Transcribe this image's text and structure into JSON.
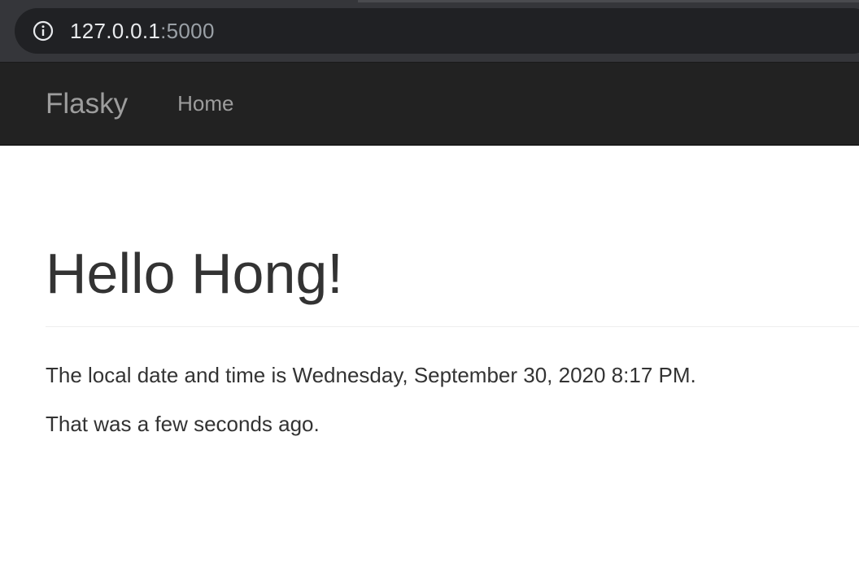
{
  "browser": {
    "url_host": "127.0.0.1",
    "url_port": ":5000",
    "info_icon": "info-icon"
  },
  "navbar": {
    "brand": "Flasky",
    "links": [
      {
        "label": "Home"
      }
    ]
  },
  "main": {
    "title": "Hello Hong!",
    "datetime_text": "The local date and time is Wednesday, September 30, 2020 8:17 PM.",
    "relative_text": "That was a few seconds ago."
  },
  "colors": {
    "chrome_bg": "#35363a",
    "address_bg": "#202124",
    "navbar_bg": "#222222",
    "navbar_text": "#9d9d9d",
    "body_text": "#333333"
  }
}
